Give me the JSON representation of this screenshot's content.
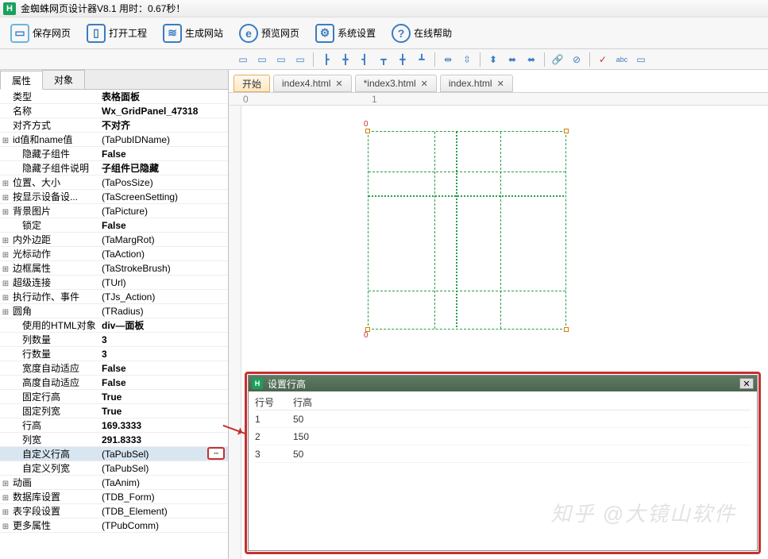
{
  "title": "金蜘蛛网页设计器V8.1  用时：0.67秒！",
  "toolbar": {
    "save": "保存网页",
    "open_proj": "打开工程",
    "gen_site": "生成网站",
    "preview": "预览网页",
    "settings": "系统设置",
    "help": "在线帮助"
  },
  "proptabs": {
    "attr": "属性",
    "obj": "对象"
  },
  "props": [
    {
      "exp": false,
      "label": "类型",
      "val": "表格面板",
      "bold": true
    },
    {
      "exp": false,
      "label": "名称",
      "val": "Wx_GridPanel_47318",
      "bold": true
    },
    {
      "exp": false,
      "label": "对齐方式",
      "val": "不对齐",
      "bold": true
    },
    {
      "exp": true,
      "label": "id值和name值",
      "val": "(TaPubIDName)"
    },
    {
      "exp": false,
      "label": "隐藏子组件",
      "val": "False",
      "bold": true,
      "ind": true
    },
    {
      "exp": false,
      "label": "隐藏子组件说明",
      "val": "子组件已隐藏",
      "bold": true,
      "ind": true
    },
    {
      "exp": true,
      "label": "位置、大小",
      "val": "(TaPosSize)"
    },
    {
      "exp": true,
      "label": "按显示设备设...",
      "val": "(TaScreenSetting)"
    },
    {
      "exp": true,
      "label": "背景图片",
      "val": "(TaPicture)"
    },
    {
      "exp": false,
      "label": "锁定",
      "val": "False",
      "bold": true,
      "ind": true
    },
    {
      "exp": true,
      "label": "内外边距",
      "val": "(TaMargRot)"
    },
    {
      "exp": true,
      "label": "光标动作",
      "val": "(TaAction)"
    },
    {
      "exp": true,
      "label": "边框属性",
      "val": "(TaStrokeBrush)"
    },
    {
      "exp": true,
      "label": "超级连接",
      "val": "(TUrl)"
    },
    {
      "exp": true,
      "label": "执行动作、事件",
      "val": "(TJs_Action)"
    },
    {
      "exp": true,
      "label": "圆角",
      "val": "(TRadius)"
    },
    {
      "exp": false,
      "label": "使用的HTML对象",
      "val": "div—面板",
      "bold": true,
      "ind": true
    },
    {
      "exp": false,
      "label": "列数量",
      "val": "3",
      "bold": true,
      "ind": true
    },
    {
      "exp": false,
      "label": "行数量",
      "val": "3",
      "bold": true,
      "ind": true
    },
    {
      "exp": false,
      "label": "宽度自动适应",
      "val": "False",
      "bold": true,
      "ind": true
    },
    {
      "exp": false,
      "label": "高度自动适应",
      "val": "False",
      "bold": true,
      "ind": true
    },
    {
      "exp": false,
      "label": "固定行高",
      "val": "True",
      "bold": true,
      "ind": true
    },
    {
      "exp": false,
      "label": "固定列宽",
      "val": "True",
      "bold": true,
      "ind": true
    },
    {
      "exp": false,
      "label": "行高",
      "val": "169.3333",
      "bold": true,
      "ind": true
    },
    {
      "exp": false,
      "label": "列宽",
      "val": "291.8333",
      "bold": true,
      "ind": true
    },
    {
      "exp": false,
      "label": "自定义行高",
      "val": "(TaPubSel)",
      "ind": true,
      "sel": true,
      "btn": true
    },
    {
      "exp": false,
      "label": "自定义列宽",
      "val": "(TaPubSel)",
      "ind": true
    },
    {
      "exp": true,
      "label": "动画",
      "val": "(TaAnim)"
    },
    {
      "exp": true,
      "label": "数据库设置",
      "val": "(TDB_Form)"
    },
    {
      "exp": true,
      "label": "表字段设置",
      "val": "(TDB_Element)"
    },
    {
      "exp": true,
      "label": "更多属性",
      "val": "(TPubComm)"
    }
  ],
  "doctabs": {
    "start": "开始",
    "t1": "index4.html",
    "t2": "*index3.html",
    "t3": "index.html"
  },
  "ruler": {
    "m0": "0",
    "m1": "1"
  },
  "dialog": {
    "title": "设置行高",
    "col1": "行号",
    "col2": "行高",
    "rows": [
      {
        "n": "1",
        "h": "50"
      },
      {
        "n": "2",
        "h": "150"
      },
      {
        "n": "3",
        "h": "50"
      }
    ]
  },
  "watermark": "知乎 @大镜山软件"
}
